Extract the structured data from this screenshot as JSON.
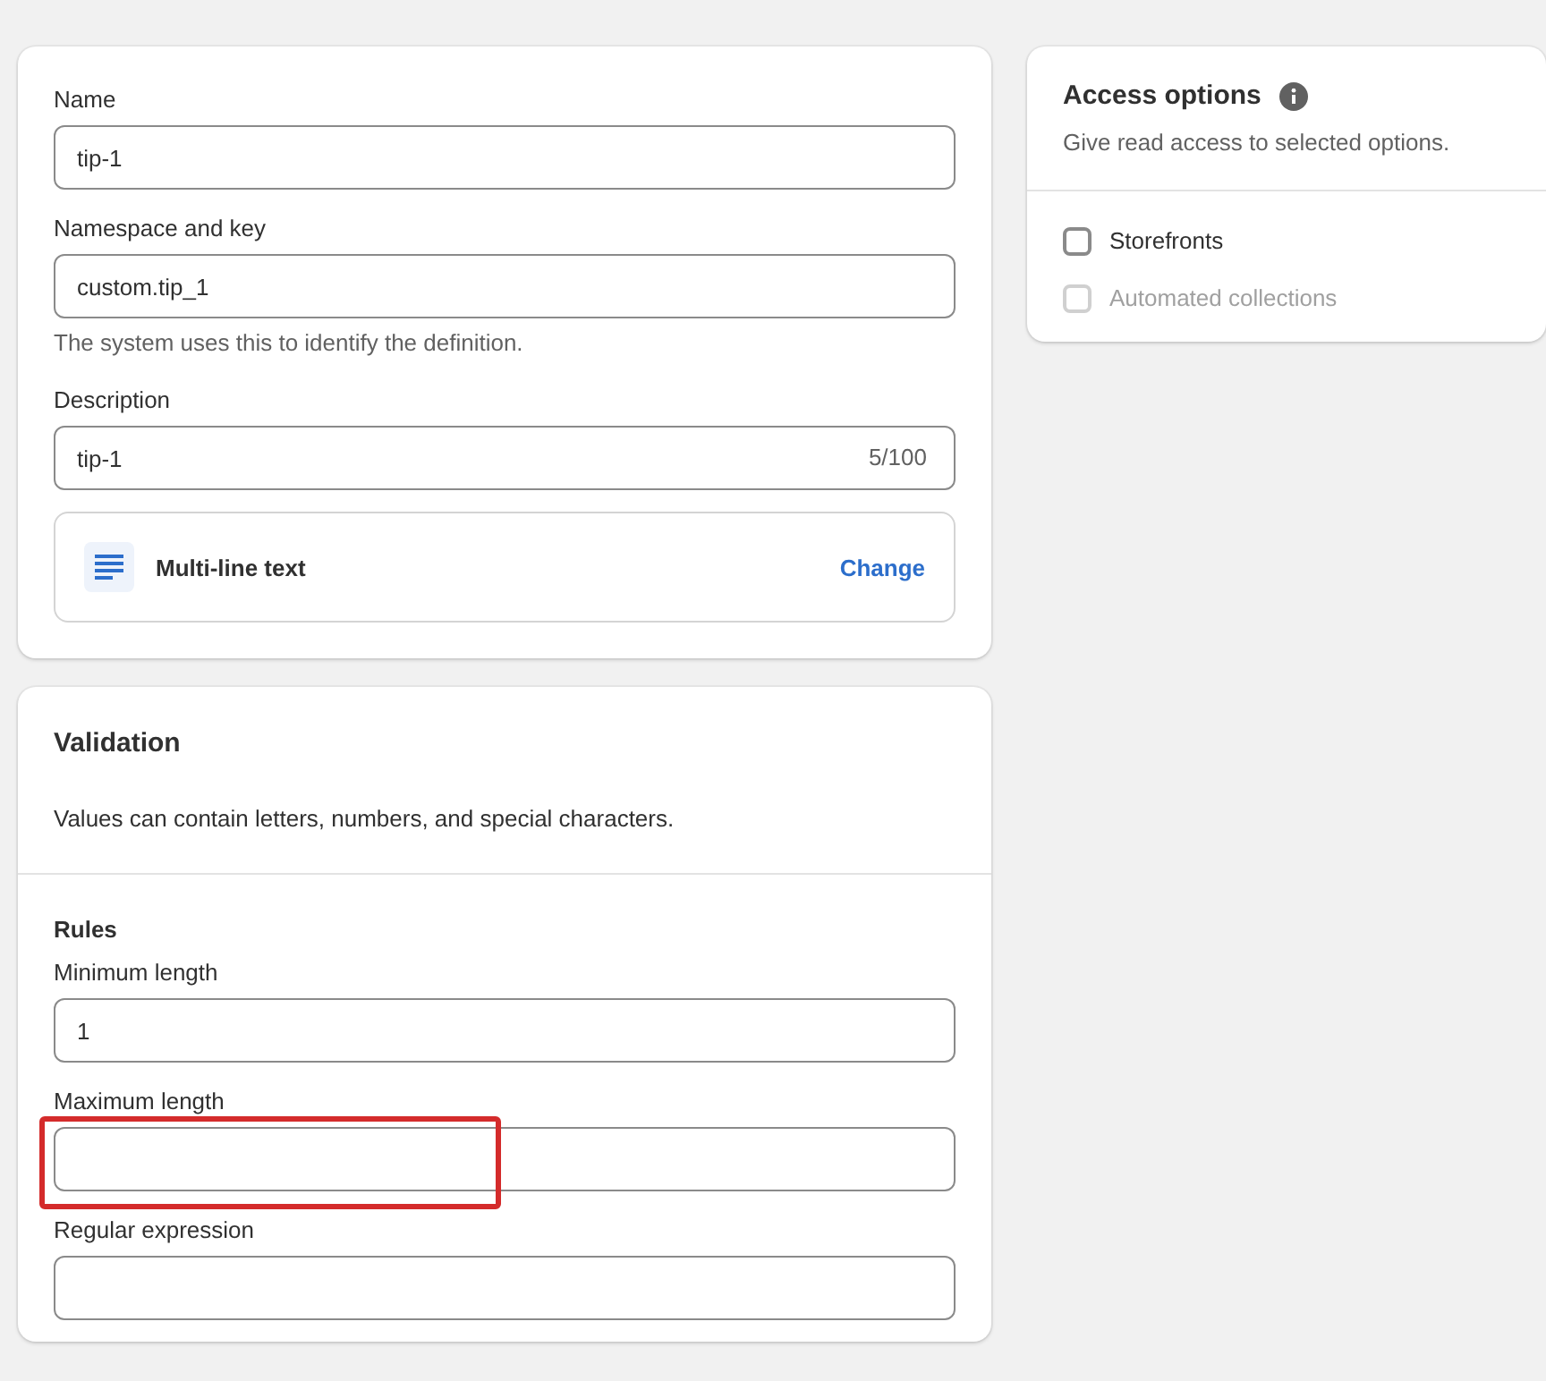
{
  "definition": {
    "fields": [
      {
        "label": "Name",
        "value": "tip-1"
      },
      {
        "label": "Namespace and key",
        "value": "custom.tip_1",
        "help": "The system uses this to identify the definition."
      },
      {
        "label": "Description",
        "value": "tip-1",
        "counter": "5/100"
      }
    ],
    "type": {
      "label": "Multi-line text",
      "action": "Change"
    }
  },
  "validation": {
    "title": "Validation",
    "description": "Values can contain letters, numbers, and special characters.",
    "rules_title": "Rules",
    "fields": [
      {
        "label": "Minimum length",
        "value": "1",
        "highlighted": false
      },
      {
        "label": "Maximum length",
        "highlighted": true
      },
      {
        "label": "Regular expression",
        "highlighted": false
      }
    ]
  },
  "access": {
    "title": "Access options",
    "subtitle": "Give read access to selected options.",
    "options": [
      {
        "label": "Storefronts",
        "checked": false,
        "disabled": false
      },
      {
        "label": "Automated collections",
        "checked": false,
        "disabled": true
      }
    ]
  }
}
